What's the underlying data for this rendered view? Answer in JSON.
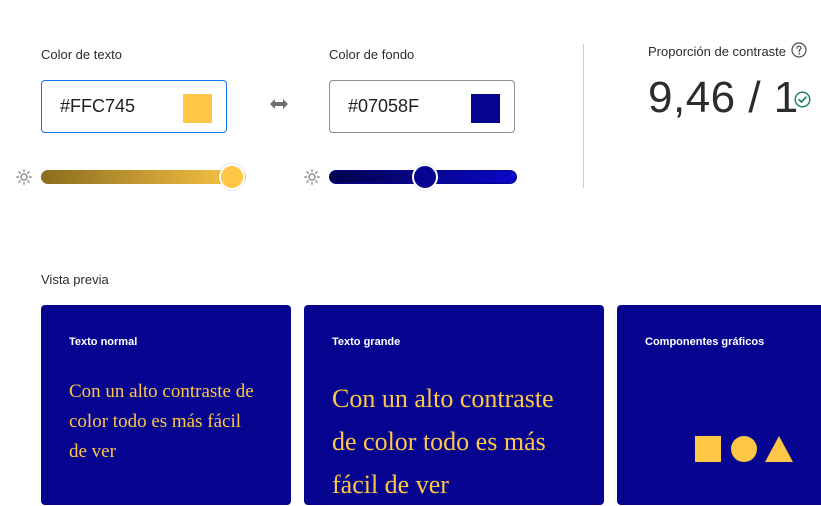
{
  "text_color": {
    "label": "Color de texto",
    "value": "#FFC745",
    "swatch": "#FFC745",
    "slider_position": 0.93
  },
  "background_color": {
    "label": "Color de fondo",
    "value": "#07058F",
    "swatch": "#07058F",
    "slider_position": 0.51
  },
  "contrast": {
    "label": "Proporción de contraste",
    "value": "9,46 / 1",
    "status_color": "#12805c"
  },
  "icons": {
    "swap": "swap-arrows-icon",
    "brightness": "sun-icon",
    "help": "help-circle-icon",
    "pass": "check-circle-icon"
  },
  "preview": {
    "label": "Vista previa",
    "cards": [
      {
        "title": "Texto normal",
        "text": "Con un alto contraste de color todo es más fácil de ver"
      },
      {
        "title": "Texto grande",
        "text": "Con un alto contraste de color todo es más fácil de ver"
      },
      {
        "title": "Componentes gráficos"
      }
    ]
  }
}
